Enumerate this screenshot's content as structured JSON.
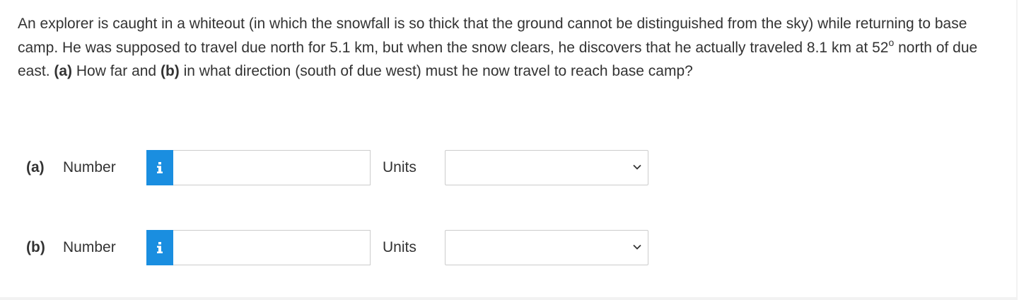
{
  "question": {
    "text_1": "An explorer is caught in a whiteout (in which the snowfall is so thick that the ground cannot be distinguished from the sky) while returning to base camp. He was supposed to travel due north for 5.1 km, but when the snow clears, he discovers that he actually traveled 8.1 km at 52",
    "degree_symbol": "o",
    "text_2": " north of due east. ",
    "part_a_marker": "(a)",
    "text_3": " How far and ",
    "part_b_marker": "(b)",
    "text_4": " in what direction (south of due west) must he now travel to reach base camp?"
  },
  "answers": [
    {
      "part": "(a)",
      "number_label": "Number",
      "number_value": "",
      "units_label": "Units",
      "units_selected": ""
    },
    {
      "part": "(b)",
      "number_label": "Number",
      "number_value": "",
      "units_label": "Units",
      "units_selected": ""
    }
  ],
  "colors": {
    "info_button": "#1a8ee0",
    "text": "#333333",
    "border": "#cccccc"
  },
  "icons": {
    "info": "info-icon",
    "dropdown": "chevron-down-icon"
  }
}
